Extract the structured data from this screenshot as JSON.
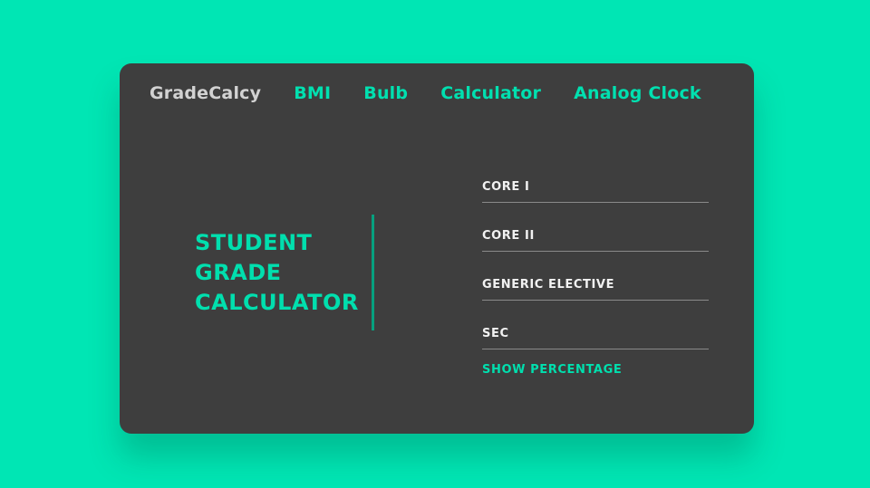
{
  "nav": {
    "brand": "GradeCalcy",
    "links": [
      "BMI",
      "Bulb",
      "Calculator",
      "Analog Clock"
    ]
  },
  "title": {
    "lines": [
      "STUDENT",
      "GRADE",
      "CALCULATOR"
    ]
  },
  "form": {
    "fields": [
      {
        "placeholder": "CORE I",
        "value": ""
      },
      {
        "placeholder": "CORE II",
        "value": ""
      },
      {
        "placeholder": "GENERIC ELECTIVE",
        "value": ""
      },
      {
        "placeholder": "SEC",
        "value": ""
      }
    ],
    "submit_label": "SHOW PERCENTAGE"
  },
  "colors": {
    "background": "#00e6b4",
    "card": "#3e3e3e",
    "accent": "#00dfae",
    "brand_text": "#d2d2d2",
    "divider": "#06a17f"
  }
}
